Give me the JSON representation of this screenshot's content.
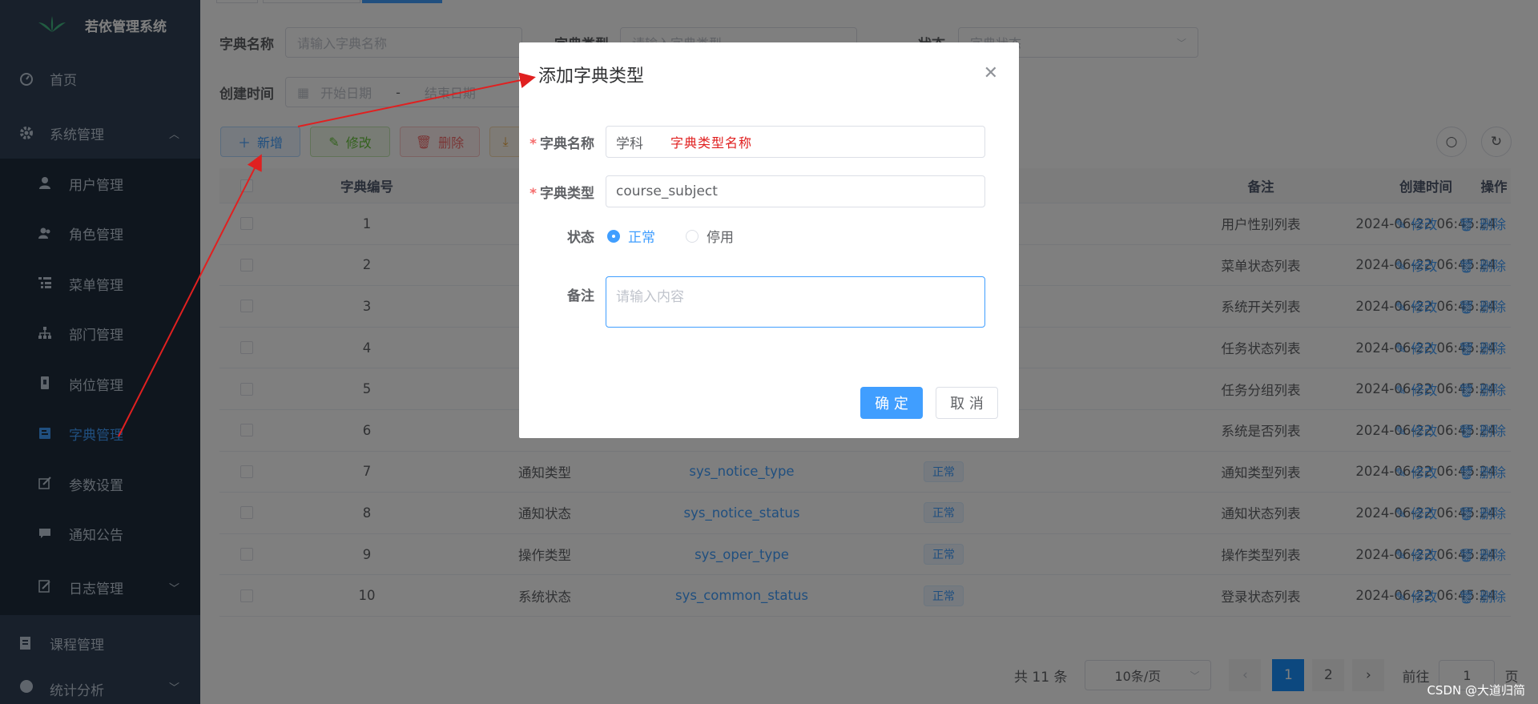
{
  "app": {
    "title": "若依管理系统"
  },
  "sidebar": {
    "home": "首页",
    "system": "系统管理",
    "items": [
      {
        "label": "用户管理"
      },
      {
        "label": "角色管理"
      },
      {
        "label": "菜单管理"
      },
      {
        "label": "部门管理"
      },
      {
        "label": "岗位管理"
      },
      {
        "label": "字典管理"
      },
      {
        "label": "参数设置"
      },
      {
        "label": "通知公告"
      },
      {
        "label": "日志管理"
      }
    ],
    "course": "课程管理",
    "stats": "统计分析"
  },
  "search": {
    "dict_name_label": "字典名称",
    "dict_name_placeholder": "请输入字典名称",
    "dict_type_label": "字典类型",
    "dict_type_placeholder": "请输入字典类型",
    "status_label": "状态",
    "status_placeholder": "字典状态",
    "created_label": "创建时间",
    "start_placeholder": "开始日期",
    "sep": "-",
    "end_placeholder": "结束日期"
  },
  "toolbar": {
    "add": "新增",
    "edit": "修改",
    "delete": "删除"
  },
  "table": {
    "headers": {
      "id": "字典编号",
      "remark": "备注",
      "created": "创建时间",
      "ops": "操作"
    },
    "rows": [
      {
        "id": "1",
        "name": "",
        "type": "",
        "status": "",
        "remark": "用户性别列表",
        "created": "2024-06-22 06:45:24"
      },
      {
        "id": "2",
        "name": "",
        "type": "",
        "status": "",
        "remark": "菜单状态列表",
        "created": "2024-06-22 06:45:24"
      },
      {
        "id": "3",
        "name": "",
        "type": "",
        "status": "",
        "remark": "系统开关列表",
        "created": "2024-06-22 06:45:24"
      },
      {
        "id": "4",
        "name": "",
        "type": "",
        "status": "",
        "remark": "任务状态列表",
        "created": "2024-06-22 06:45:24"
      },
      {
        "id": "5",
        "name": "",
        "type": "",
        "status": "",
        "remark": "任务分组列表",
        "created": "2024-06-22 06:45:24"
      },
      {
        "id": "6",
        "name": "",
        "type": "",
        "status": "",
        "remark": "系统是否列表",
        "created": "2024-06-22 06:45:24"
      },
      {
        "id": "7",
        "name": "通知类型",
        "type": "sys_notice_type",
        "status": "正常",
        "remark": "通知类型列表",
        "created": "2024-06-22 06:45:24"
      },
      {
        "id": "8",
        "name": "通知状态",
        "type": "sys_notice_status",
        "status": "正常",
        "remark": "通知状态列表",
        "created": "2024-06-22 06:45:24"
      },
      {
        "id": "9",
        "name": "操作类型",
        "type": "sys_oper_type",
        "status": "正常",
        "remark": "操作类型列表",
        "created": "2024-06-22 06:45:24"
      },
      {
        "id": "10",
        "name": "系统状态",
        "type": "sys_common_status",
        "status": "正常",
        "remark": "登录状态列表",
        "created": "2024-06-22 06:45:24"
      }
    ],
    "edit": "修改",
    "delete": "删除"
  },
  "pagination": {
    "total": "共 11 条",
    "page_size": "10条/页",
    "pages": [
      "1",
      "2"
    ],
    "goto": "前往",
    "goto_value": "1",
    "page_suffix": "页"
  },
  "dialog": {
    "title": "添加字典类型",
    "name_label": "字典名称",
    "name_value": "学科",
    "name_annotation": "字典类型名称",
    "type_label": "字典类型",
    "type_value": "course_subject",
    "status_label": "状态",
    "status_normal": "正常",
    "status_disabled": "停用",
    "remark_label": "备注",
    "remark_placeholder": "请输入内容",
    "confirm": "确 定",
    "cancel": "取 消"
  },
  "watermark": "CSDN @大道归简",
  "colors": {
    "primary": "#409eff",
    "sidebar": "#304156",
    "annotation": "#e02020"
  }
}
